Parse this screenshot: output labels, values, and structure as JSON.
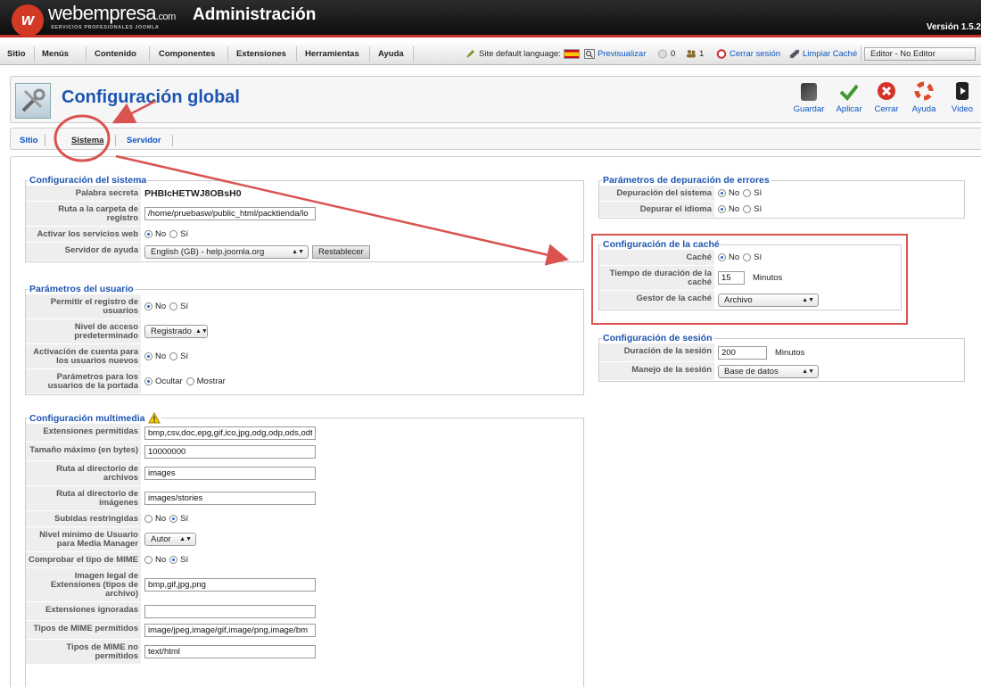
{
  "header": {
    "logo_mark": "w",
    "logo_name": "webempresa",
    "logo_com": ".com",
    "logo_tagline": "SERVICIOS PROFESIONALES JOOMLA",
    "title": "Administración",
    "version": "Versión 1.5.2"
  },
  "menu": {
    "items": [
      "Sitio",
      "Menús",
      "Contenido",
      "Componentes",
      "Extensiones",
      "Herramientas",
      "Ayuda"
    ]
  },
  "status": {
    "language": "Site default language:",
    "preview": "Previsualizar",
    "messages": "0",
    "users": "1",
    "logout": "Cerrar sesión",
    "clear_cache": "Limpiar Caché",
    "editor": "Editor - No Editor"
  },
  "page": {
    "title": "Configuración global"
  },
  "toolbar": {
    "save": "Guardar",
    "apply": "Aplicar",
    "close": "Cerrar",
    "help": "Ayuda",
    "video": "Video"
  },
  "tabs": [
    "Sitio",
    "Sistema",
    "Servidor"
  ],
  "radio": {
    "no": "No",
    "yes": "Sí",
    "hide": "Ocultar",
    "show": "Mostrar"
  },
  "system": {
    "legend": "Configuración del sistema",
    "secret_label": "Palabra secreta",
    "secret_value": "PHBIcHETWJ8OBsH0",
    "log_label": "Ruta a la carpeta de registro",
    "log_value": "/home/pruebasw/public_html/packtienda/lo",
    "web_services_label": "Activar los servicios web",
    "help_server_label": "Servidor de ayuda",
    "help_server_value": "English (GB) - help.joomla.org",
    "reset_button": "Restablecer"
  },
  "user": {
    "legend": "Parámetros del usuario",
    "allow_reg_label": "Permitir el registro de usuarios",
    "access_label": "Nivel de acceso predeterminado",
    "access_value": "Registrado",
    "activation_label": "Activación de cuenta para los usuarios nuevos",
    "frontend_label": "Parámetros para los usuarios de la portada"
  },
  "media": {
    "legend": "Configuración multimedia",
    "ext_label": "Extensiones permitidas",
    "ext_value": "bmp,csv,doc,epg,gif,ico,jpg,odg,odp,ods,odt",
    "maxsize_label": "Tamaño máximo (en bytes)",
    "maxsize_value": "10000000",
    "files_label": "Ruta al directorio de archivos",
    "files_value": "images",
    "images_label": "Ruta al directorio de imágenes",
    "images_value": "images/stories",
    "restrict_label": "Subidas restringidas",
    "minuser_label": "Nivel mínimo de Usuario para Media Manager",
    "minuser_value": "Autor",
    "mime_check_label": "Comprobar el tipo de MIME",
    "legal_img_label": "Imagen legal de Extensiones (tipos de archivo)",
    "legal_img_value": "bmp,gif,jpg,png",
    "ignored_label": "Extensiones ignoradas",
    "ignored_value": "",
    "mime_allowed_label": "Tipos de MIME permitidos",
    "mime_allowed_value": "image/jpeg,image/gif,image/png,image/bm",
    "mime_denied_label": "Tipos de MIME no permitidos",
    "mime_denied_value": "text/html"
  },
  "debug": {
    "legend": "Parámetros de depuración de errores",
    "system_label": "Depuración del sistema",
    "lang_label": "Depurar el idioma"
  },
  "cache": {
    "legend": "Configuración de la caché",
    "cache_label": "Caché",
    "time_label": "Tiempo de duración de la caché",
    "time_value": "15",
    "time_unit": "Minutos",
    "handler_label": "Gestor de la caché",
    "handler_value": "Archivo"
  },
  "session": {
    "legend": "Configuración de sesión",
    "lifetime_label": "Duración de la sesión",
    "lifetime_value": "200",
    "lifetime_unit": "Minutos",
    "handler_label": "Manejo de la sesión",
    "handler_value": "Base de datos"
  },
  "colors": {
    "accent": "#1d55b0",
    "link": "#0b55c4",
    "annotation": "#d9534f",
    "header_bg": "#1a1a1a"
  }
}
